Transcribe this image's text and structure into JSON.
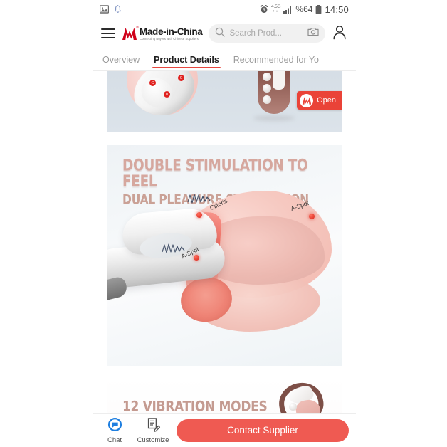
{
  "status_bar": {
    "icons": [
      "image-icon",
      "bell-icon",
      "alarm-icon",
      "network-4.5g-icon",
      "signal-icon",
      "battery-icon"
    ],
    "network_label": "4.5G",
    "network_sub": "↑↓",
    "battery_percent": "%64",
    "time": "14:50"
  },
  "header": {
    "menu_icon": "hamburger-menu-icon",
    "logo": {
      "name": "Made-in-China",
      "tagline": "Connecting Buyers with Chinese Suppliers",
      "registered_mark": "®",
      "brand_color": "#d0021b"
    },
    "search": {
      "placeholder": "Search Prod...",
      "search_icon": "search-icon",
      "camera_icon": "camera-icon"
    },
    "account_icon": "user-account-icon"
  },
  "tabs": [
    {
      "label": "Overview",
      "active": false
    },
    {
      "label": "Product Details",
      "active": true
    },
    {
      "label": "Recommended for Yo",
      "active": false
    }
  ],
  "tab_accent_color": "#e8473f",
  "content": {
    "block1": {
      "callout_dots": [
        "G",
        "C",
        "U"
      ],
      "open_badge": {
        "label": "Open",
        "background": "#ea4338"
      }
    },
    "block2": {
      "headline": "DOUBLE STIMULATION TO FEEL",
      "subheadline": "DUAL PLEASURE STIMULATION",
      "headline_color": "#d6a79e",
      "labels": [
        {
          "text": "Clitoris"
        },
        {
          "text": "A-Spot"
        },
        {
          "text": "A-Spot"
        }
      ]
    },
    "block3": {
      "headline": "12 VIBRATION MODES",
      "headline_color": "#c49a90"
    }
  },
  "bottom_bar": {
    "chat": {
      "label": "Chat",
      "icon": "chat-bubble-icon",
      "color": "#1f7fe0"
    },
    "customize": {
      "label": "Customize",
      "icon": "document-edit-icon"
    },
    "contact_button": {
      "label": "Contact Supplier",
      "background": "#ef5a52"
    }
  }
}
